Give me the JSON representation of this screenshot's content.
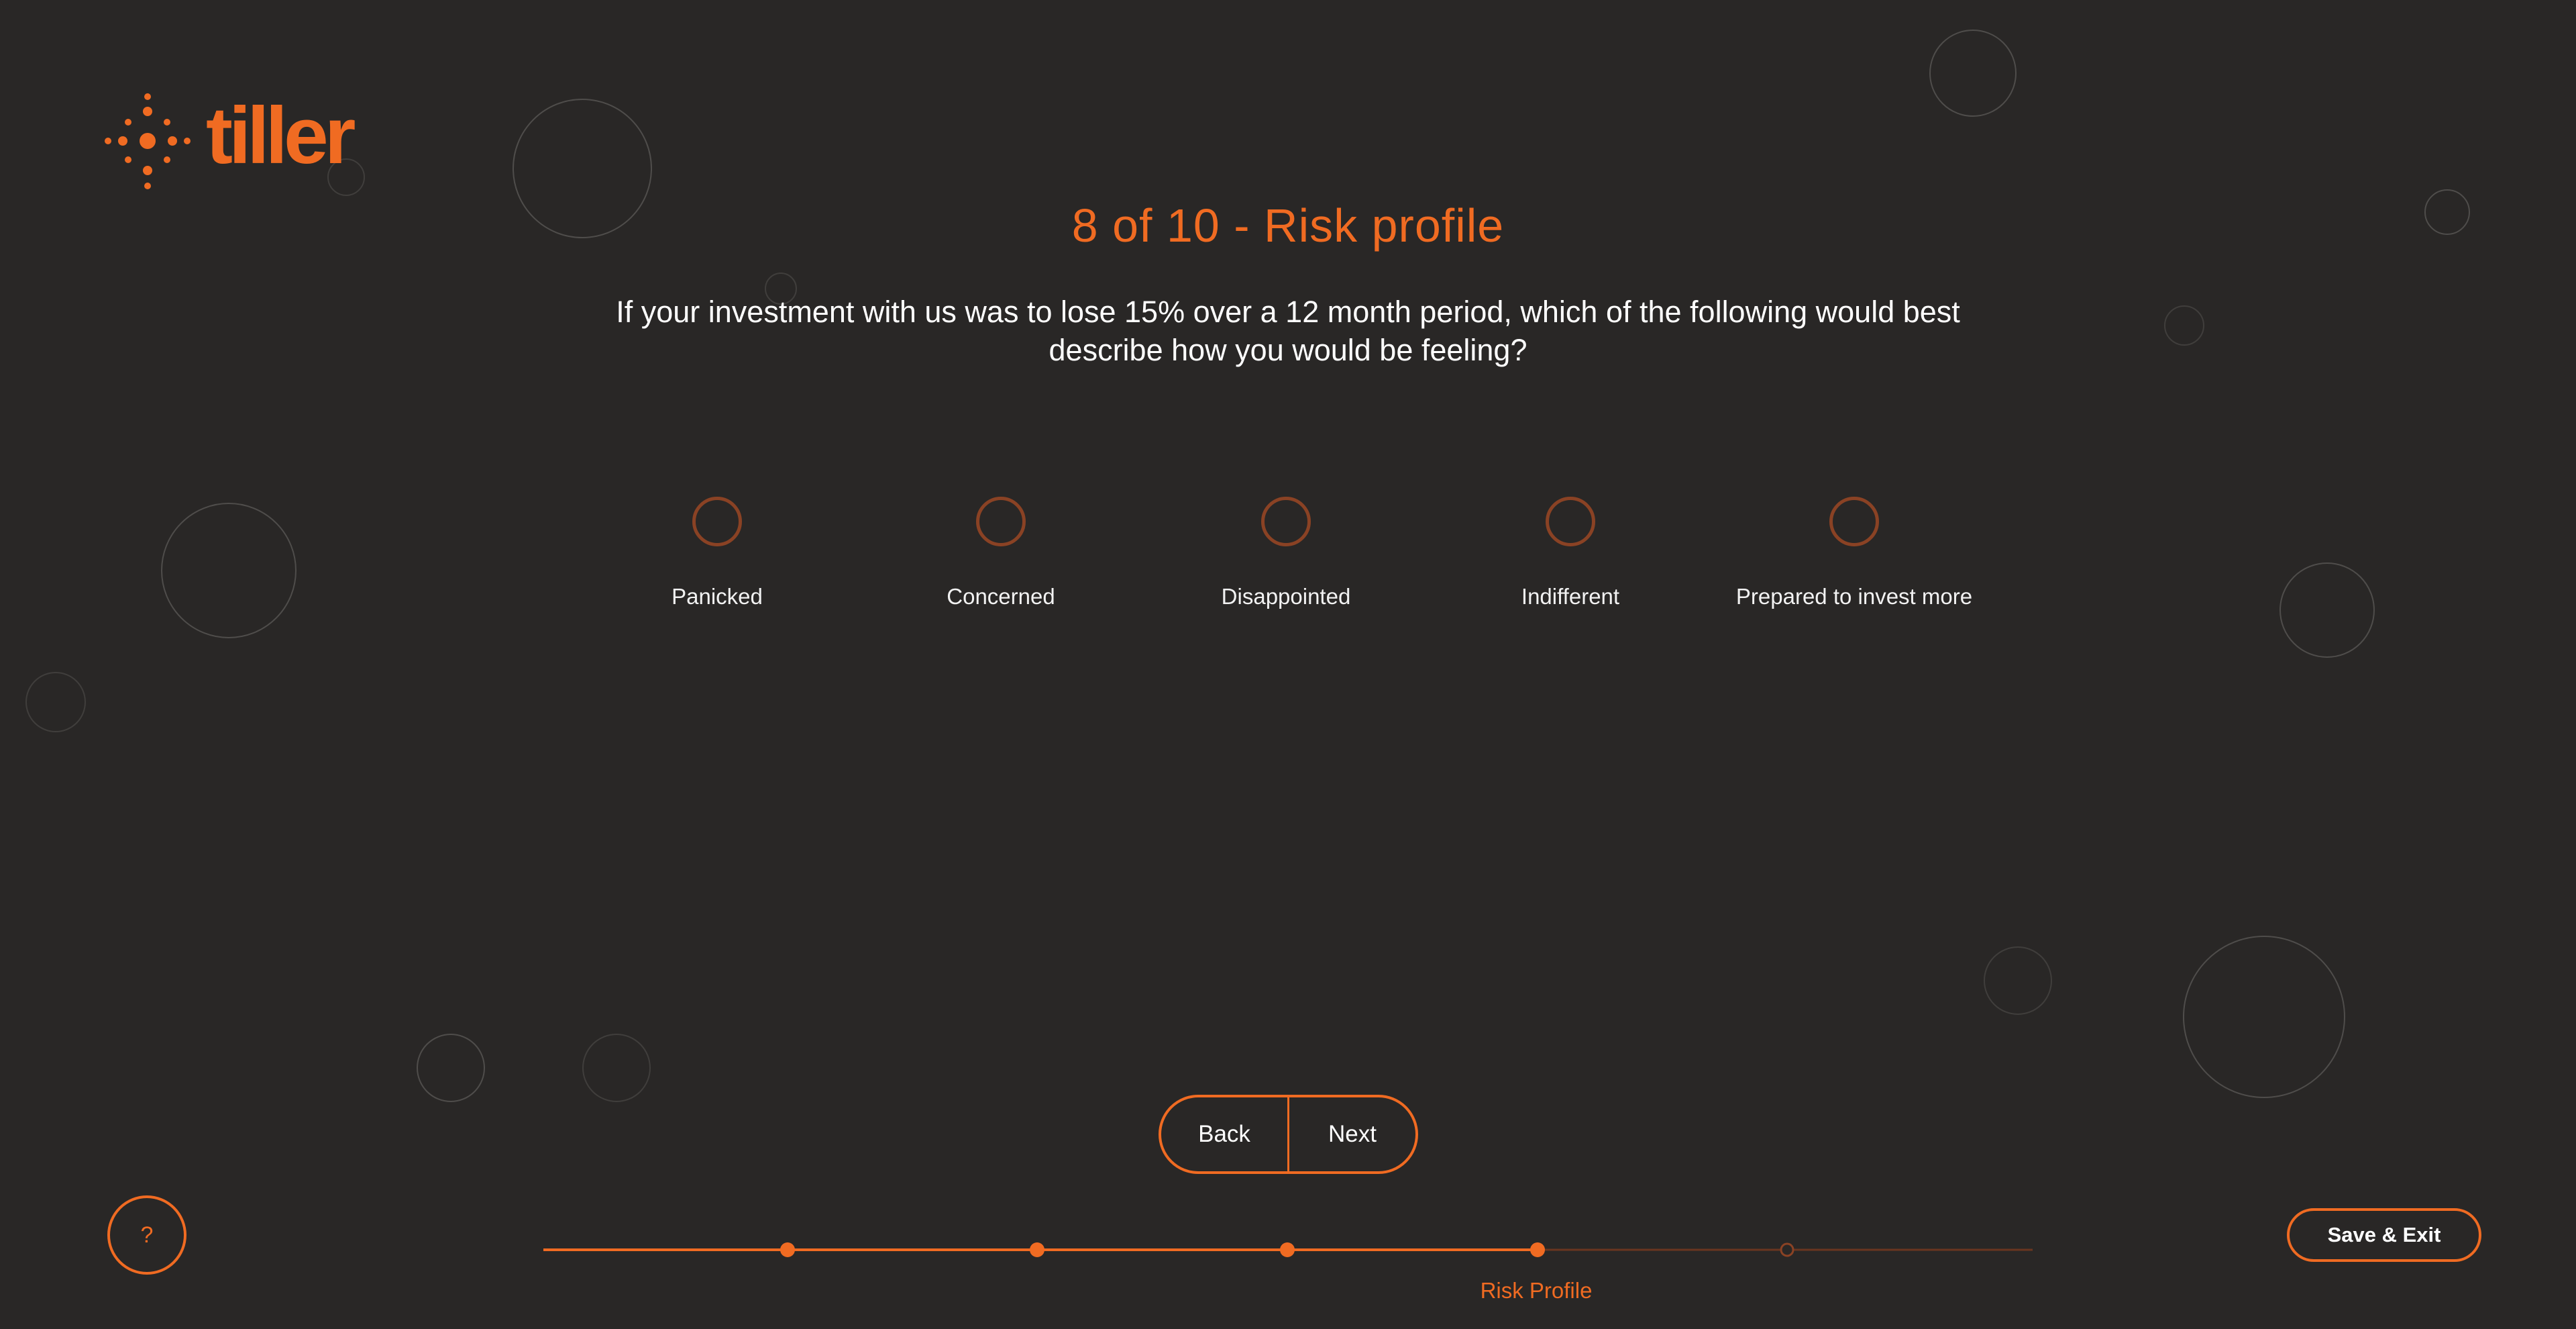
{
  "brand": {
    "name": "tiller",
    "accent": "#f06b22",
    "background": "#292726"
  },
  "title": "8 of 10 - Risk profile",
  "question": "If your investment with us was to lose 15% over a 12 month period, which of the following would best describe how you would be feeling?",
  "options": [
    {
      "label": "Panicked",
      "selected": false
    },
    {
      "label": "Concerned",
      "selected": false
    },
    {
      "label": "Disappointed",
      "selected": false
    },
    {
      "label": "Indifferent",
      "selected": false
    },
    {
      "label": "Prepared to invest more",
      "selected": false
    }
  ],
  "navigation": {
    "back_label": "Back",
    "next_label": "Next"
  },
  "help": {
    "label": "?"
  },
  "save_exit_label": "Save & Exit",
  "progress": {
    "total_steps": 5,
    "completed_steps": 4,
    "current_step_label": "Risk Profile"
  },
  "icons": {
    "help": "question-mark-icon",
    "logo": "tiller-dots-logo-icon"
  }
}
